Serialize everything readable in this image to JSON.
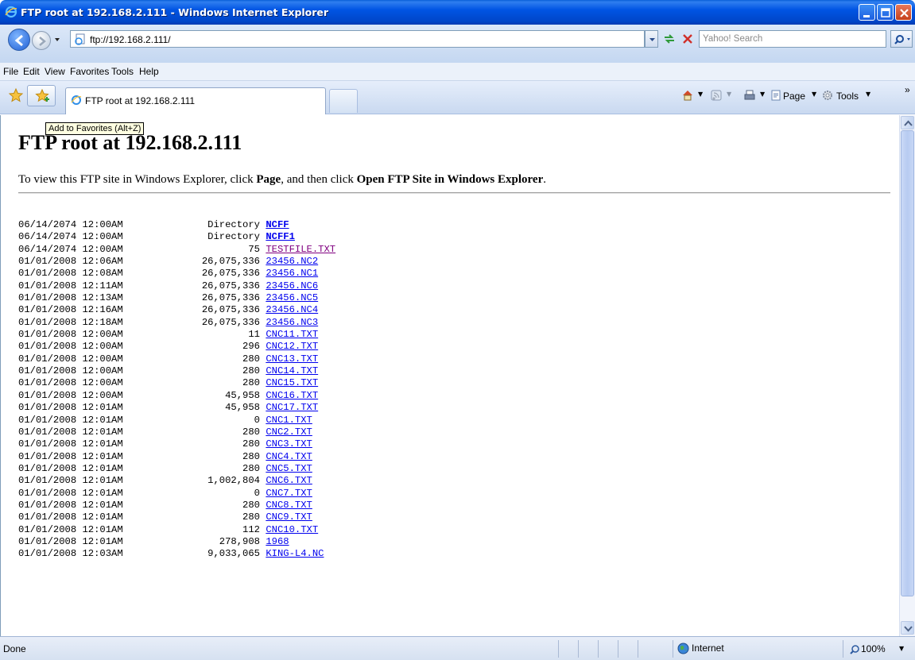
{
  "window": {
    "title": "FTP root at 192.168.2.111 - Windows Internet Explorer"
  },
  "address_bar": {
    "url": "ftp://192.168.2.111/",
    "search_placeholder": "Yahoo! Search"
  },
  "menu": {
    "items": [
      "File",
      "Edit",
      "View",
      "Favorites",
      "Tools",
      "Help"
    ]
  },
  "tabs": [
    {
      "title": "FTP root at 192.168.2.111"
    }
  ],
  "command_bar": {
    "page_label": "Page",
    "tools_label": "Tools",
    "more_label": "»"
  },
  "tooltip": "Add to Favorites (Alt+Z)",
  "page": {
    "title": "FTP root at 192.168.2.111",
    "instructions_pre": "To view this FTP site in Windows Explorer, click ",
    "instructions_page": "Page",
    "instructions_mid": ", and then click ",
    "instructions_open": "Open FTP Site in Windows Explorer",
    "instructions_end": "."
  },
  "listing": [
    {
      "date": "06/14/2074 12:00AM",
      "size": "Directory",
      "name": "NCFF",
      "bold": true,
      "visited": false
    },
    {
      "date": "06/14/2074 12:00AM",
      "size": "Directory",
      "name": "NCFF1",
      "bold": true,
      "visited": false
    },
    {
      "date": "06/14/2074 12:00AM",
      "size": "75",
      "name": "TESTFILE.TXT",
      "bold": false,
      "visited": true
    },
    {
      "date": "01/01/2008 12:06AM",
      "size": "26,075,336",
      "name": "23456.NC2",
      "bold": false,
      "visited": false
    },
    {
      "date": "01/01/2008 12:08AM",
      "size": "26,075,336",
      "name": "23456.NC1",
      "bold": false,
      "visited": false
    },
    {
      "date": "01/01/2008 12:11AM",
      "size": "26,075,336",
      "name": "23456.NC6",
      "bold": false,
      "visited": false
    },
    {
      "date": "01/01/2008 12:13AM",
      "size": "26,075,336",
      "name": "23456.NC5",
      "bold": false,
      "visited": false
    },
    {
      "date": "01/01/2008 12:16AM",
      "size": "26,075,336",
      "name": "23456.NC4",
      "bold": false,
      "visited": false
    },
    {
      "date": "01/01/2008 12:18AM",
      "size": "26,075,336",
      "name": "23456.NC3",
      "bold": false,
      "visited": false
    },
    {
      "date": "01/01/2008 12:00AM",
      "size": "11",
      "name": "CNC11.TXT",
      "bold": false,
      "visited": false
    },
    {
      "date": "01/01/2008 12:00AM",
      "size": "296",
      "name": "CNC12.TXT",
      "bold": false,
      "visited": false
    },
    {
      "date": "01/01/2008 12:00AM",
      "size": "280",
      "name": "CNC13.TXT",
      "bold": false,
      "visited": false
    },
    {
      "date": "01/01/2008 12:00AM",
      "size": "280",
      "name": "CNC14.TXT",
      "bold": false,
      "visited": false
    },
    {
      "date": "01/01/2008 12:00AM",
      "size": "280",
      "name": "CNC15.TXT",
      "bold": false,
      "visited": false
    },
    {
      "date": "01/01/2008 12:00AM",
      "size": "45,958",
      "name": "CNC16.TXT",
      "bold": false,
      "visited": false
    },
    {
      "date": "01/01/2008 12:01AM",
      "size": "45,958",
      "name": "CNC17.TXT",
      "bold": false,
      "visited": false
    },
    {
      "date": "01/01/2008 12:01AM",
      "size": "0",
      "name": "CNC1.TXT",
      "bold": false,
      "visited": false
    },
    {
      "date": "01/01/2008 12:01AM",
      "size": "280",
      "name": "CNC2.TXT",
      "bold": false,
      "visited": false
    },
    {
      "date": "01/01/2008 12:01AM",
      "size": "280",
      "name": "CNC3.TXT",
      "bold": false,
      "visited": false
    },
    {
      "date": "01/01/2008 12:01AM",
      "size": "280",
      "name": "CNC4.TXT",
      "bold": false,
      "visited": false
    },
    {
      "date": "01/01/2008 12:01AM",
      "size": "280",
      "name": "CNC5.TXT",
      "bold": false,
      "visited": false
    },
    {
      "date": "01/01/2008 12:01AM",
      "size": "1,002,804",
      "name": "CNC6.TXT",
      "bold": false,
      "visited": false
    },
    {
      "date": "01/01/2008 12:01AM",
      "size": "0",
      "name": "CNC7.TXT",
      "bold": false,
      "visited": false
    },
    {
      "date": "01/01/2008 12:01AM",
      "size": "280",
      "name": "CNC8.TXT",
      "bold": false,
      "visited": false
    },
    {
      "date": "01/01/2008 12:01AM",
      "size": "280",
      "name": "CNC9.TXT",
      "bold": false,
      "visited": false
    },
    {
      "date": "01/01/2008 12:01AM",
      "size": "112",
      "name": "CNC10.TXT",
      "bold": false,
      "visited": false
    },
    {
      "date": "01/01/2008 12:01AM",
      "size": "278,908",
      "name": "1968",
      "bold": false,
      "visited": false
    },
    {
      "date": "01/01/2008 12:03AM",
      "size": "9,033,065",
      "name": "KING-L4.NC",
      "bold": false,
      "visited": false
    }
  ],
  "status_bar": {
    "status": "Done",
    "zone": "Internet",
    "zoom": "100%"
  },
  "colors": {
    "link": "#0000ee",
    "visited": "#800080",
    "titlebar": "#0054e3"
  },
  "icons": [
    "ie-logo-icon",
    "minimize-icon",
    "maximize-icon",
    "close-icon",
    "back-icon",
    "forward-icon",
    "refresh-icon",
    "stop-icon",
    "search-icon",
    "favorites-star-icon",
    "add-favorites-icon",
    "home-icon",
    "feeds-icon",
    "print-icon",
    "page-icon",
    "tools-gear-icon",
    "globe-icon",
    "zoom-icon"
  ]
}
